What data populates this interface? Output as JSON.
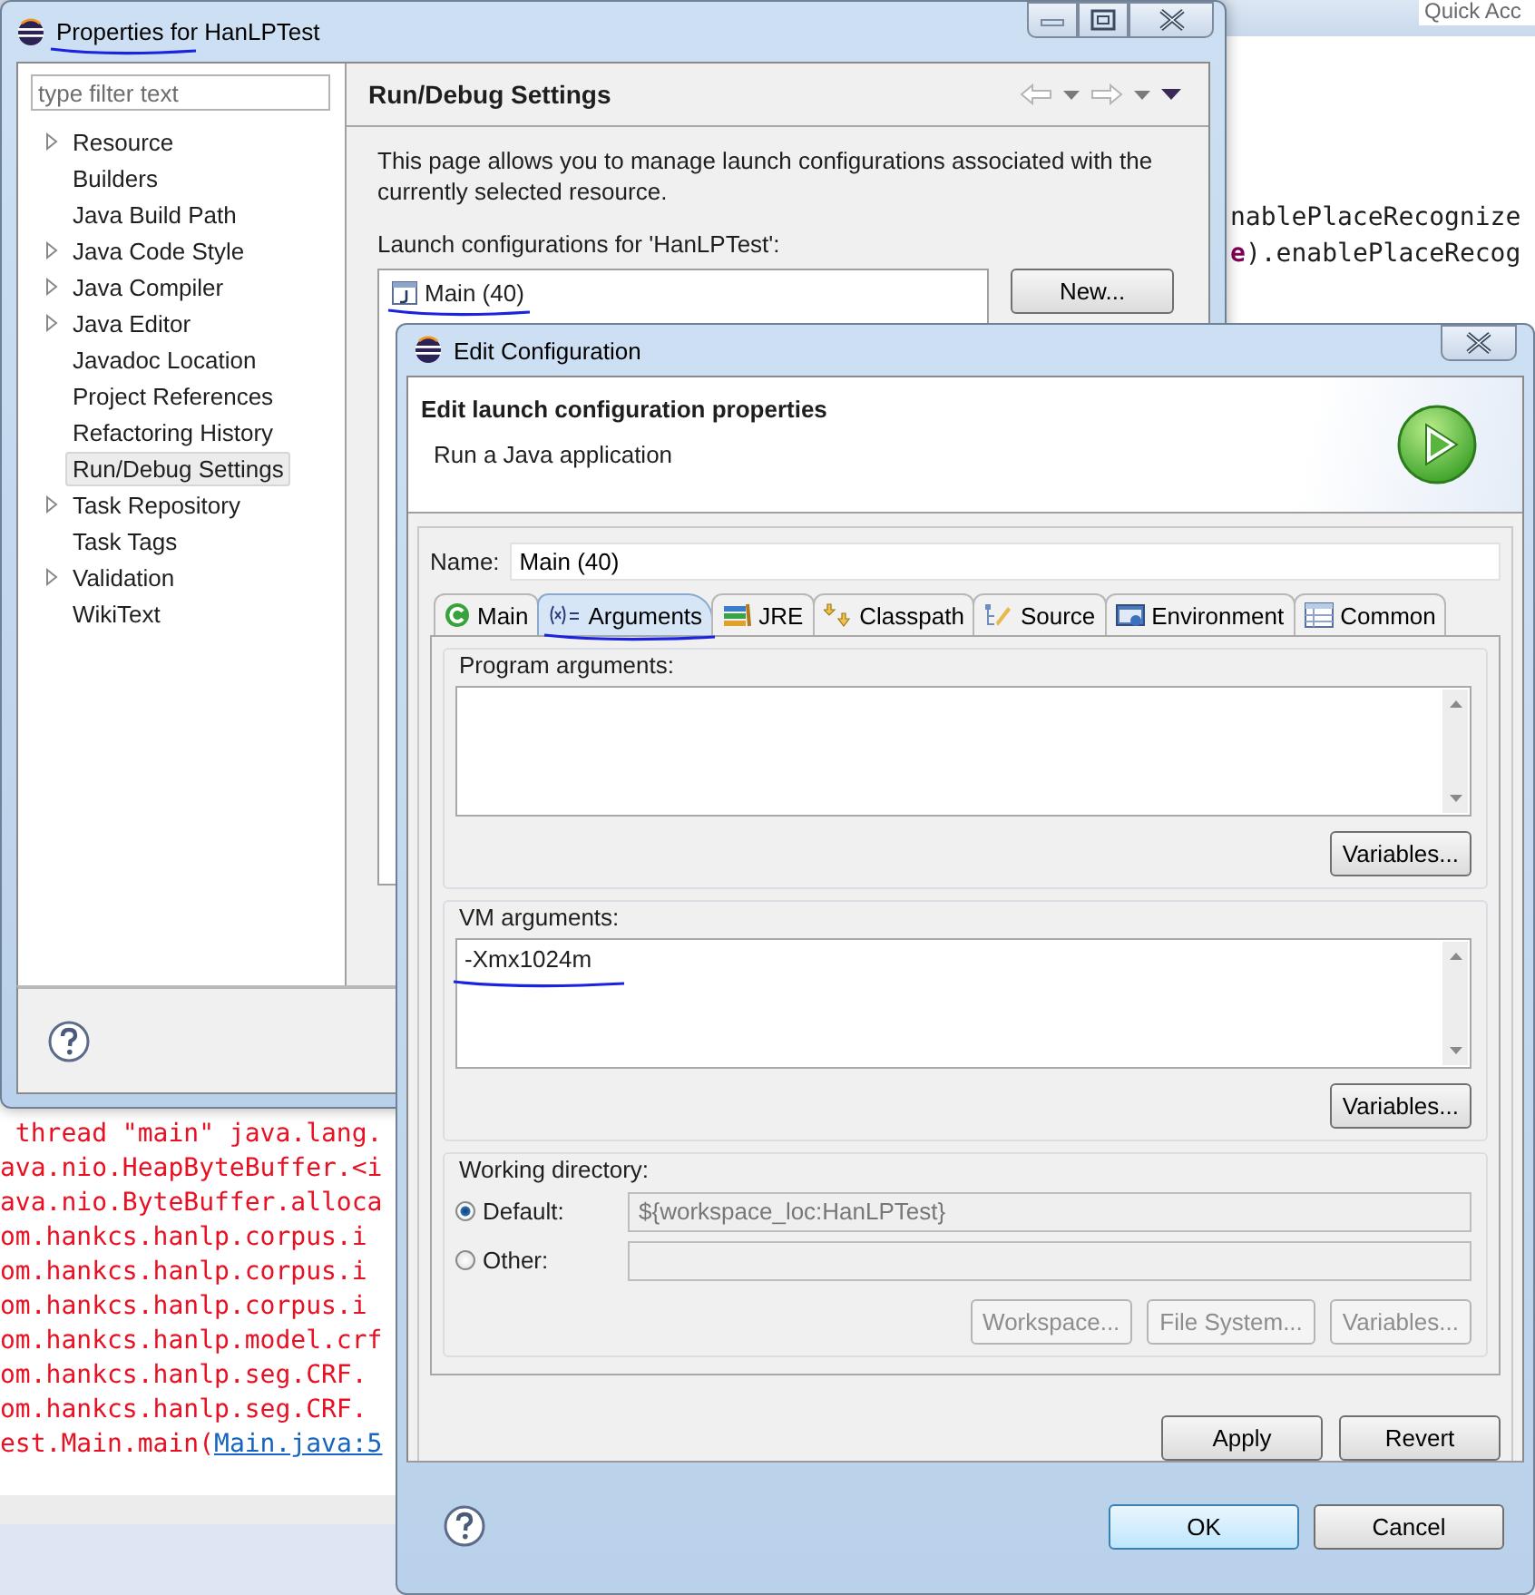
{
  "background": {
    "quick_access": "Quick Acc",
    "code_lines": [
      [
        {
          "kind": "plain",
          "text": "nablePlaceRecognize"
        }
      ],
      [
        {
          "kind": "keyword",
          "text": "e"
        },
        {
          "kind": "plain",
          "text": ").enablePlaceRecog"
        }
      ]
    ],
    "console_lines": [
      {
        "text": " thread \"main\" java.lang."
      },
      {
        "text": "ava.nio.HeapByteBuffer.<i"
      },
      {
        "text": "ava.nio.ByteBuffer.alloca"
      },
      {
        "text": "om.hankcs.hanlp.corpus.i"
      },
      {
        "text": "om.hankcs.hanlp.corpus.i"
      },
      {
        "text": "om.hankcs.hanlp.corpus.i"
      },
      {
        "text": "om.hankcs.hanlp.model.crf"
      },
      {
        "text": "om.hankcs.hanlp.seg.CRF."
      },
      {
        "text": "om.hankcs.hanlp.seg.CRF."
      },
      {
        "text": "est.Main.main(",
        "link": "Main.java:5"
      }
    ]
  },
  "properties_window": {
    "title": "Properties for HanLPTest",
    "filter": {
      "placeholder": "type filter text"
    },
    "tree": [
      {
        "label": "Resource",
        "has_children": true,
        "selected": false
      },
      {
        "label": "Builders",
        "has_children": false,
        "selected": false
      },
      {
        "label": "Java Build Path",
        "has_children": false,
        "selected": false
      },
      {
        "label": "Java Code Style",
        "has_children": true,
        "selected": false
      },
      {
        "label": "Java Compiler",
        "has_children": true,
        "selected": false
      },
      {
        "label": "Java Editor",
        "has_children": true,
        "selected": false
      },
      {
        "label": "Javadoc Location",
        "has_children": false,
        "selected": false
      },
      {
        "label": "Project References",
        "has_children": false,
        "selected": false
      },
      {
        "label": "Refactoring History",
        "has_children": false,
        "selected": false
      },
      {
        "label": "Run/Debug Settings",
        "has_children": false,
        "selected": true
      },
      {
        "label": "Task Repository",
        "has_children": true,
        "selected": false
      },
      {
        "label": "Task Tags",
        "has_children": false,
        "selected": false
      },
      {
        "label": "Validation",
        "has_children": true,
        "selected": false
      },
      {
        "label": "WikiText",
        "has_children": false,
        "selected": false
      }
    ],
    "page": {
      "title": "Run/Debug Settings",
      "description": "This page allows you to manage launch configurations associated with the currently selected resource.",
      "list_label": "Launch configurations for 'HanLPTest':",
      "configurations": [
        {
          "label": "Main (40)",
          "selected": false
        }
      ],
      "buttons": [
        "New..."
      ]
    }
  },
  "edit_dialog": {
    "title": "Edit Configuration",
    "header": {
      "title": "Edit launch configuration properties",
      "subtitle": "Run a Java application"
    },
    "name": {
      "label": "Name:",
      "value": "Main (40)"
    },
    "tabs": [
      {
        "label": "Main",
        "kind": "main",
        "selected": false
      },
      {
        "label": "Arguments",
        "kind": "arguments",
        "selected": true
      },
      {
        "label": "JRE",
        "kind": "jre",
        "selected": false
      },
      {
        "label": "Classpath",
        "kind": "classpath",
        "selected": false
      },
      {
        "label": "Source",
        "kind": "source",
        "selected": false
      },
      {
        "label": "Environment",
        "kind": "environment",
        "selected": false
      },
      {
        "label": "Common",
        "kind": "common",
        "selected": false
      }
    ],
    "program_arguments": {
      "label": "Program arguments:",
      "button": "Variables..."
    },
    "vm_arguments": {
      "label": "VM arguments:",
      "value": "-Xmx1024m",
      "button": "Variables..."
    },
    "working_directory": {
      "label": "Working directory:",
      "options": [
        {
          "label": "Default:",
          "selected": true,
          "value": "${workspace_loc:HanLPTest}"
        },
        {
          "label": "Other:",
          "selected": false
        }
      ],
      "buttons": [
        {
          "label": "Workspace...",
          "disabled": true
        },
        {
          "label": "File System...",
          "disabled": true
        },
        {
          "label": "Variables...",
          "disabled": true
        }
      ]
    },
    "actions": [
      "Apply",
      "Revert"
    ],
    "footer_buttons": [
      {
        "label": "OK",
        "default": true
      },
      {
        "label": "Cancel",
        "default": false
      }
    ]
  }
}
